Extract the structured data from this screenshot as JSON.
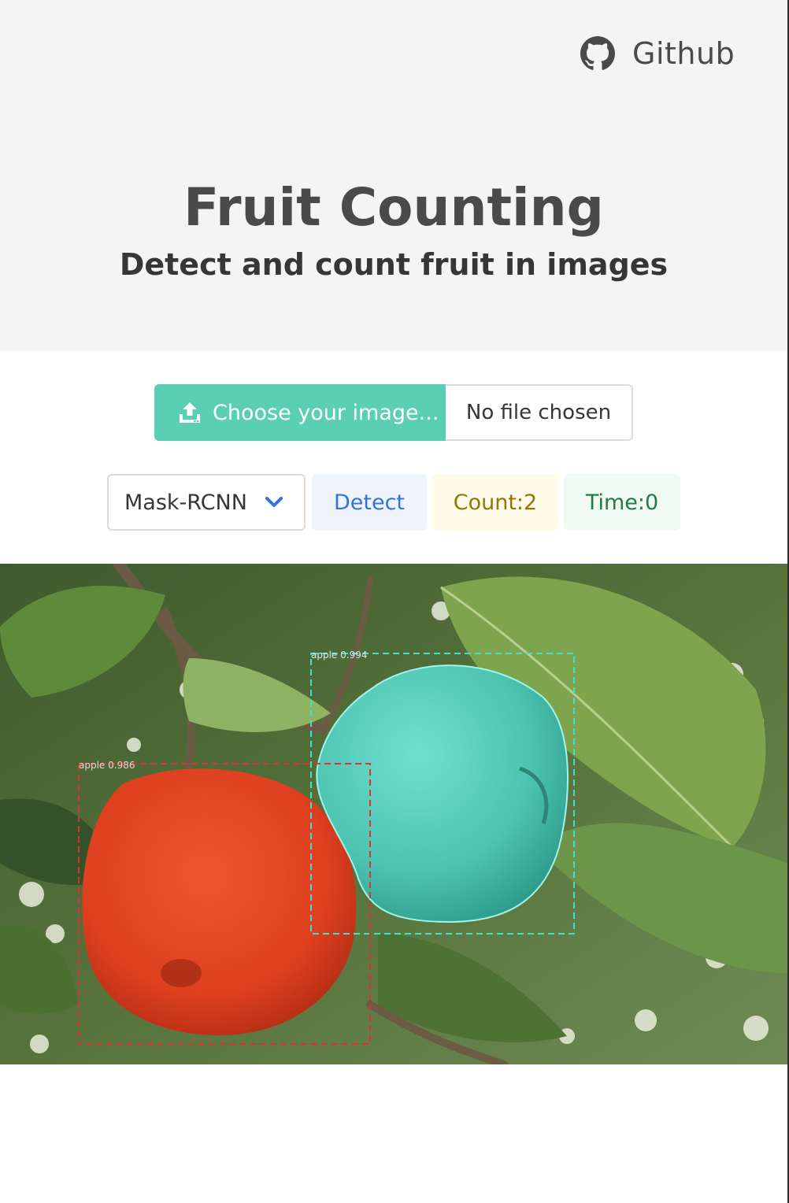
{
  "header": {
    "github_label": "Github",
    "title": "Fruit Counting",
    "subtitle": "Detect and count fruit in images"
  },
  "upload": {
    "choose_label": "Choose your image...",
    "file_name": "No file chosen",
    "icon": "upload-icon"
  },
  "controls": {
    "model_selected": "Mask-RCNN",
    "detect_label": "Detect",
    "count_label": "Count:2",
    "time_label": "Time:0"
  },
  "result_image": {
    "detections": [
      {
        "label": "apple 0.994",
        "color": "#3ee0d0"
      },
      {
        "label": "apple 0.986",
        "color": "#e03030"
      }
    ]
  },
  "colors": {
    "hero_bg": "#f4f4f4",
    "primary": "#5bcfb3",
    "link": "#3273dc",
    "warning_text": "#947600",
    "success_text": "#257942"
  }
}
